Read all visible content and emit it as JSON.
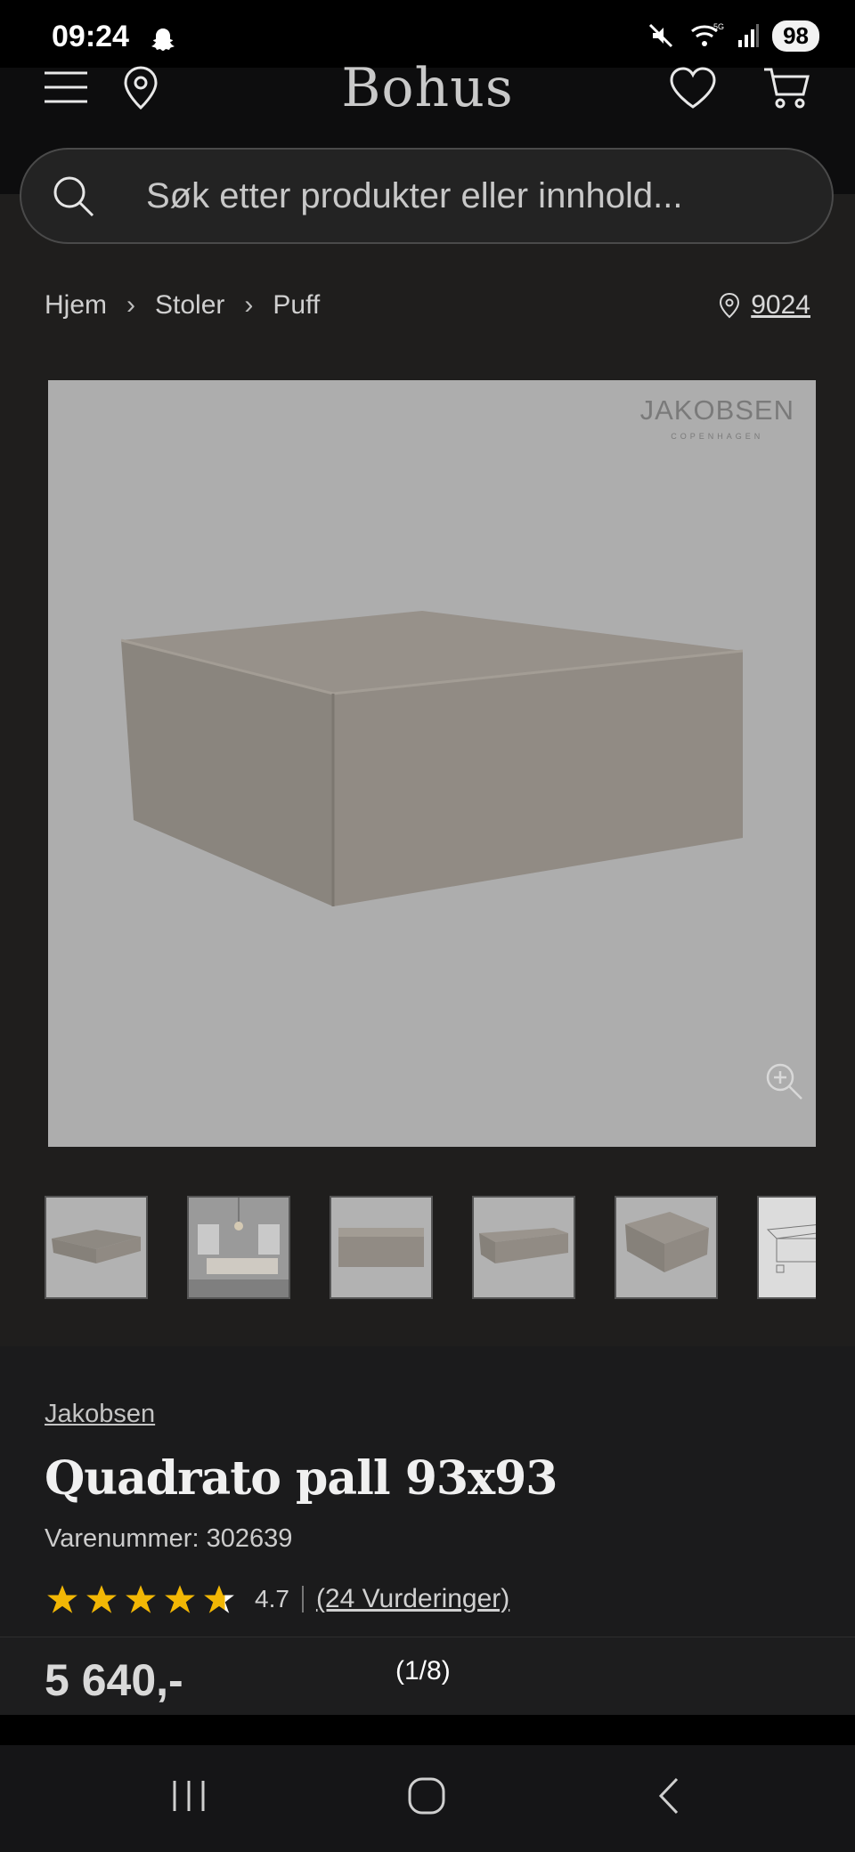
{
  "status_bar": {
    "time": "09:24",
    "battery": "98",
    "network": "5G"
  },
  "header": {
    "logo": "Bohus",
    "icons": [
      "menu-icon",
      "location-pin-icon",
      "heart-icon",
      "cart-icon"
    ]
  },
  "search": {
    "placeholder": "Søk etter produkter eller innhold..."
  },
  "breadcrumb": {
    "items": [
      "Hjem",
      "Stoler",
      "Puff"
    ],
    "postal_code": "9024"
  },
  "main_image": {
    "brand_mark": "JAKOBSEN",
    "brand_mark_sub": "COPENHAGEN"
  },
  "product": {
    "brand": "Jakobsen",
    "title": "Quadrato pall 93x93",
    "sku_label": "Varenummer: 302639",
    "rating": "4.7",
    "rating_stars": 4.7,
    "reviews_label": "(24 Vurderinger)",
    "price": "5 640,-"
  },
  "gallery": {
    "counter": "(1/8)"
  },
  "colors": {
    "background": "#1f1e1d",
    "star": "#f2b705",
    "image_bg": "#adadad"
  }
}
